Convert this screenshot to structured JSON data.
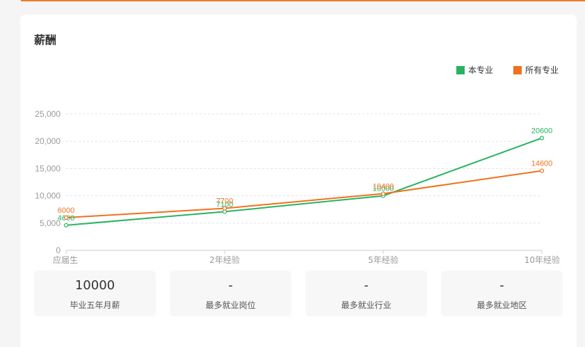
{
  "section_title": "薪酬",
  "colors": {
    "major": "#27b35f",
    "all": "#f0701e",
    "grid": "#e3e3e3",
    "axis_text": "#999999"
  },
  "chart_data": {
    "type": "line",
    "categories": [
      "应届生",
      "2年经验",
      "5年经验",
      "10年经验"
    ],
    "series": [
      {
        "name": "本专业",
        "values": [
          4600,
          7100,
          10000,
          20600
        ]
      },
      {
        "name": "所有专业",
        "values": [
          6000,
          7700,
          10400,
          14600
        ]
      }
    ],
    "ylim": [
      0,
      25000
    ],
    "yticks": [
      "0",
      "5,000",
      "10,000",
      "15,000",
      "20,000",
      "25,000"
    ],
    "grid": true,
    "legend_position": "top-right"
  },
  "stats": [
    {
      "value": "10000",
      "label": "毕业五年月薪"
    },
    {
      "value": "-",
      "label": "最多就业岗位"
    },
    {
      "value": "-",
      "label": "最多就业行业"
    },
    {
      "value": "-",
      "label": "最多就业地区"
    }
  ]
}
